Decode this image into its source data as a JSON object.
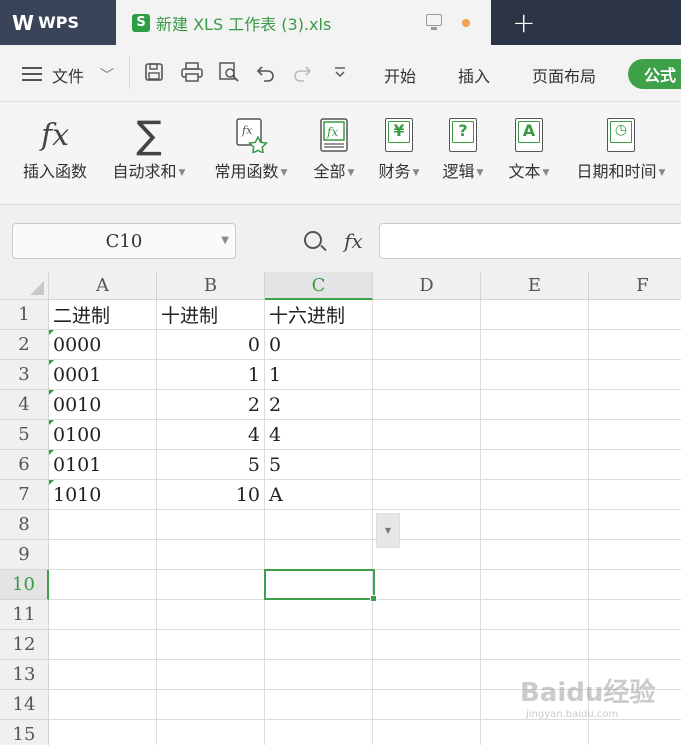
{
  "titlebar": {
    "app_name": "WPS",
    "document_name": "新建 XLS 工作表 (3).xls",
    "new_tab_label": "+"
  },
  "menubar": {
    "file_label": "文件",
    "tabs": [
      "开始",
      "插入",
      "页面布局",
      "公式"
    ],
    "active_tab": "公式"
  },
  "ribbon": {
    "buttons": [
      {
        "label": "插入函数",
        "icon": "fx-icon",
        "has_dropdown": false
      },
      {
        "label": "自动求和",
        "icon": "sigma-icon",
        "has_dropdown": true
      },
      {
        "label": "常用函数",
        "icon": "common-functions-icon",
        "has_dropdown": true
      },
      {
        "label": "全部",
        "icon": "all-functions-icon",
        "has_dropdown": true
      },
      {
        "label": "财务",
        "icon": "finance-icon",
        "has_dropdown": true
      },
      {
        "label": "逻辑",
        "icon": "logic-icon",
        "has_dropdown": true
      },
      {
        "label": "文本",
        "icon": "text-icon",
        "has_dropdown": true
      },
      {
        "label": "日期和时间",
        "icon": "datetime-icon",
        "has_dropdown": true
      }
    ]
  },
  "formula_bar": {
    "name_box": "C10",
    "fx_label": "fx",
    "formula": ""
  },
  "sheet": {
    "columns": [
      "A",
      "B",
      "C",
      "D",
      "E",
      "F"
    ],
    "selected_column": "C",
    "rows": [
      "1",
      "2",
      "3",
      "4",
      "5",
      "6",
      "7",
      "8",
      "9",
      "10",
      "11",
      "12",
      "13",
      "14",
      "15"
    ],
    "selected_row": "10",
    "cells": [
      [
        "二进制",
        "十进制",
        "十六进制"
      ],
      [
        "0000",
        "0",
        "0"
      ],
      [
        "0001",
        "1",
        "1"
      ],
      [
        "0010",
        "2",
        "2"
      ],
      [
        "0100",
        "4",
        "4"
      ],
      [
        "0101",
        "5",
        "5"
      ],
      [
        "1010",
        "10",
        "A"
      ]
    ]
  },
  "watermark": {
    "text": "Baidu经验",
    "subtext": "jingyan.baidu.com"
  },
  "colors": {
    "accent": "#3ea14a",
    "titlebar": "#2b3445"
  }
}
